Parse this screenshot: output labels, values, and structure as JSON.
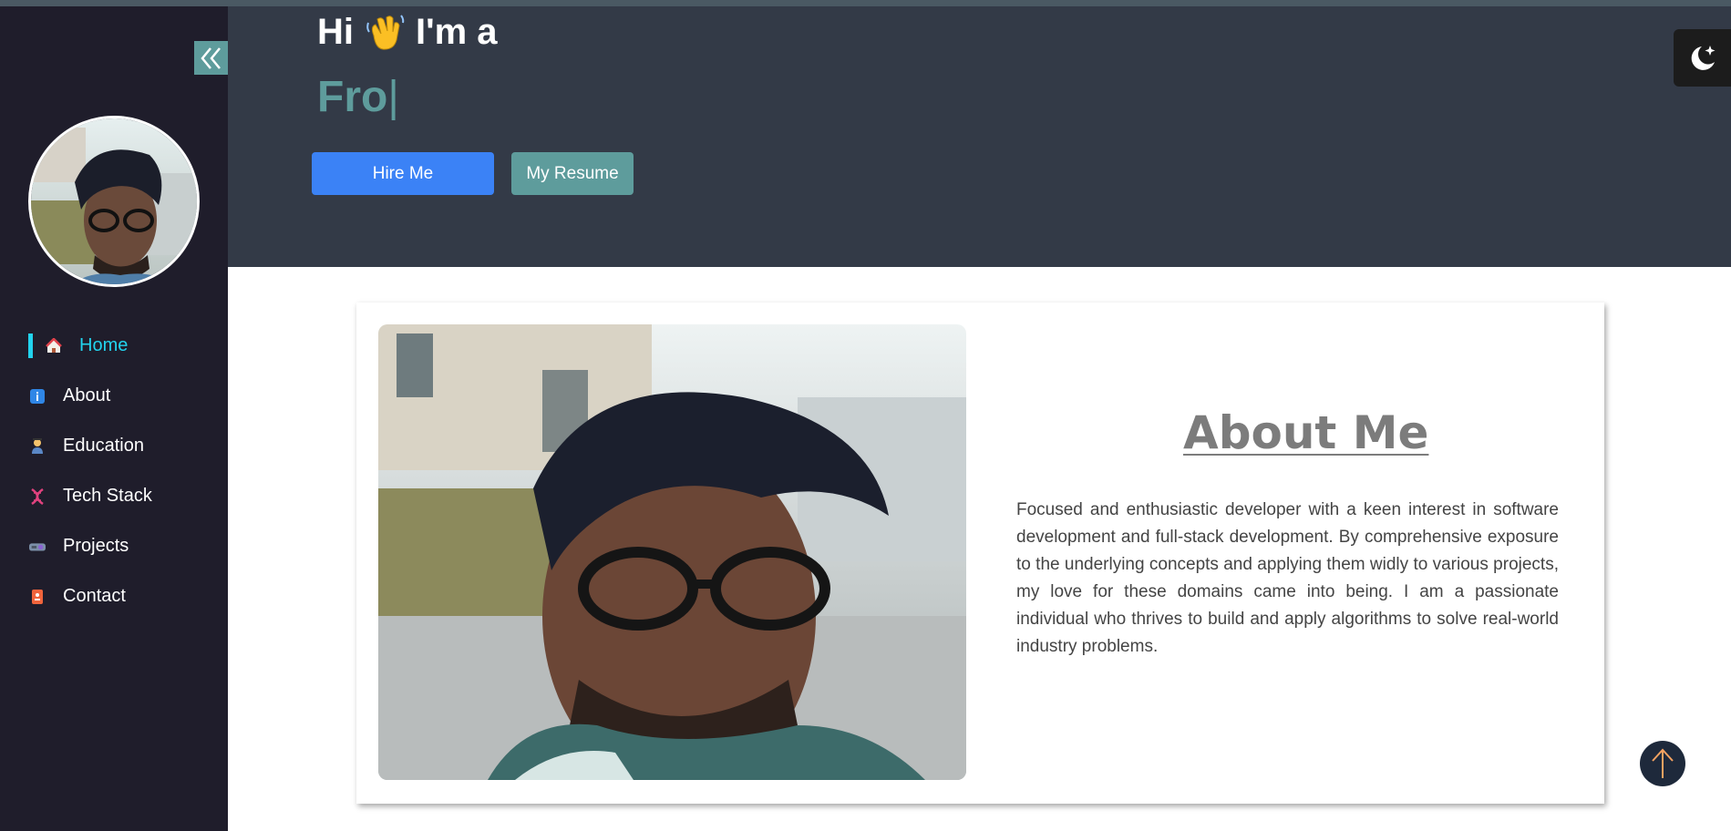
{
  "sidebar": {
    "collapse_icon": "double-chevron-left-icon",
    "nav": [
      {
        "label": "Home",
        "icon": "house-icon",
        "active": true
      },
      {
        "label": "About",
        "icon": "info-icon",
        "active": false
      },
      {
        "label": "Education",
        "icon": "student-icon",
        "active": false
      },
      {
        "label": "Tech Stack",
        "icon": "dna-icon",
        "active": false
      },
      {
        "label": "Projects",
        "icon": "projector-icon",
        "active": false
      },
      {
        "label": "Contact",
        "icon": "phone-book-icon",
        "active": false
      }
    ],
    "active_color": "#22d3ee"
  },
  "hero": {
    "greeting_pre": "Hi",
    "greeting_icon": "waving-hand-icon",
    "greeting_post": "I'm a",
    "typed_text": "Fro",
    "typed_cursor": "|",
    "hire_button": "Hire Me",
    "resume_button": "My Resume",
    "accent": "#5e9c9c",
    "primary": "#3b82f6"
  },
  "theme_toggle": {
    "icon": "moon-star-icon"
  },
  "about": {
    "title": "About Me",
    "text": "Focused and enthusiastic developer with a keen interest in software development and full-stack development. By comprehensive exposure to the underlying concepts and applying them widly to various projects, my love for these domains came into being. I am a passionate individual who thrives to build and apply algorithms to solve real-world industry problems."
  },
  "scroll_top": {
    "icon": "arrow-up-icon"
  }
}
